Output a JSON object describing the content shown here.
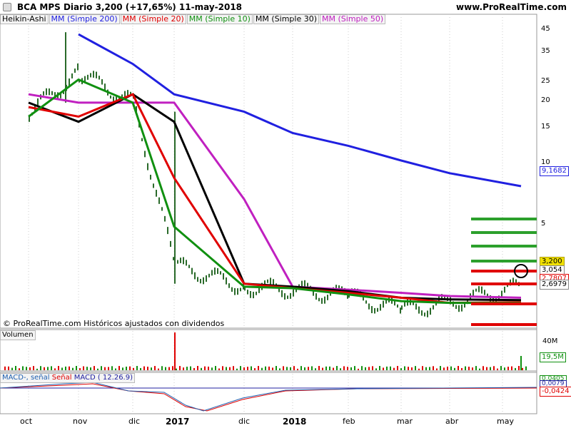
{
  "header": {
    "left": "BCA MPS   Diario   3,200 (+17,65%)   11-may-2018",
    "right": "www.ProRealTime.com"
  },
  "legend": [
    "Heikin-Ashi",
    "MM (Simple 200)",
    "MM (Simple 20)",
    "MM (Simple 10)",
    "MM (Simple 30)",
    "MM (Simple 50)"
  ],
  "colors": {
    "sma200": "#2020e0",
    "sma20": "#e00000",
    "sma10": "#109010",
    "sma30": "#000000",
    "sma50": "#c020c0",
    "candle": "#2a6a2a"
  },
  "copyright": "© ProRealTime.com  Históricos ajustados con dividendos",
  "panels": {
    "volume_label": "Volumen",
    "macd_labels": [
      "MACD-, señal",
      "Señal",
      "MACD ( 12.26.9)"
    ]
  },
  "price_axis": {
    "ticks": [
      "45",
      "35",
      "25",
      "20",
      "15",
      "10",
      "5"
    ],
    "boxes": {
      "sma200": "9,1682",
      "last": "3,200",
      "v1": "3,054",
      "v2": "2,7807",
      "v3": "2,6979"
    }
  },
  "volume_axis": {
    "ticks": [
      "40M"
    ],
    "box": "19,5M"
  },
  "macd_axis": {
    "boxes": [
      "0,0405",
      "0,0079",
      "-0,0424"
    ]
  },
  "x_axis": {
    "labels": [
      "oct",
      "nov",
      "dic",
      "2017",
      "dic",
      "2018",
      "feb",
      "mar",
      "abr",
      "may"
    ],
    "bold": [
      "2017",
      "2018"
    ]
  },
  "chart_data": {
    "type": "line",
    "scale": "log",
    "ylim": [
      2.2,
      50
    ],
    "x": [
      "oct",
      "nov",
      "dic",
      "2017",
      "dic",
      "2018",
      "feb",
      "mar",
      "abr",
      "may"
    ],
    "series": [
      {
        "name": "MM (Simple 200)",
        "values": [
          null,
          45,
          33,
          24,
          20,
          16,
          14,
          12,
          10.5,
          9.17
        ]
      },
      {
        "name": "MM (Simple 50)",
        "values": [
          24,
          22,
          22,
          22,
          8,
          3.2,
          3.1,
          3.0,
          2.9,
          2.85
        ]
      },
      {
        "name": "MM (Simple 30)",
        "values": [
          22,
          18,
          24,
          18,
          3.3,
          3.2,
          3.05,
          2.85,
          2.8,
          2.78
        ]
      },
      {
        "name": "MM (Simple 20)",
        "values": [
          21,
          19,
          24,
          10,
          3.3,
          3.15,
          3.0,
          2.85,
          2.7,
          2.72
        ]
      },
      {
        "name": "MM (Simple 10)",
        "values": [
          19,
          28,
          22,
          6,
          3.2,
          3.15,
          2.95,
          2.75,
          2.7,
          2.7
        ]
      }
    ],
    "close": [
      20,
      30,
      22,
      4.0,
      3.2,
      3.1,
      2.9,
      2.5,
      2.7,
      3.2
    ]
  }
}
